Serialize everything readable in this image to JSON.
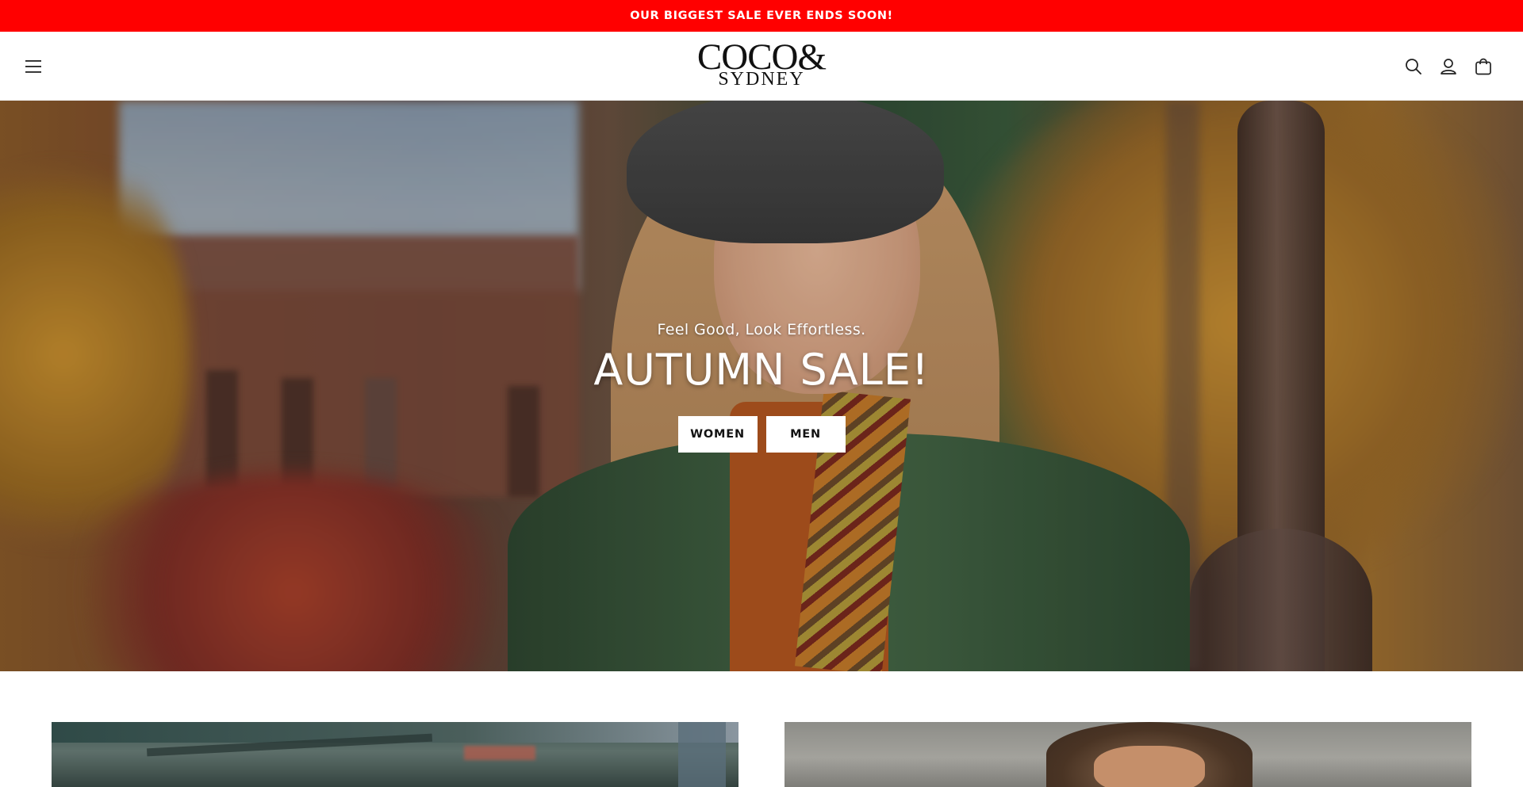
{
  "announcement": {
    "text": "OUR BIGGEST SALE EVER ENDS SOON!"
  },
  "header": {
    "menu_icon": "hamburger-menu-icon",
    "logo": {
      "line1": "COCO&",
      "line2": "SYDNEY"
    },
    "icons": [
      "search-icon",
      "account-icon",
      "cart-icon"
    ]
  },
  "hero": {
    "subheading": "Feel Good, Look Effortless.",
    "heading": "AUTUMN SALE!",
    "buttons": [
      {
        "label": "WOMEN"
      },
      {
        "label": "MEN"
      }
    ]
  },
  "colors": {
    "announcement_bg": "#ff0000",
    "button_bg": "#ffffff",
    "text_dark": "#121212"
  }
}
